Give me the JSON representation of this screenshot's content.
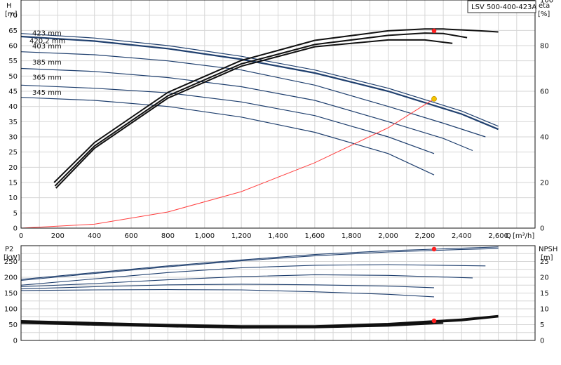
{
  "chart_data": {
    "type": "line",
    "title": "LSV 500-400-423A",
    "colors": {
      "curve": "#1f3f6e",
      "efficiency": "#111111",
      "system": "#ff4040",
      "dutyPoint": "#ff2020",
      "bep": "#f5c400",
      "grid": "#d6d6d6"
    },
    "head": {
      "ylabel": "H",
      "yunit": "[m]",
      "ylabel_right": "eta",
      "yunit_right": "[%]",
      "xlabel": "Q",
      "xunit": "[m³/h]",
      "xlim": [
        0,
        2800
      ],
      "ylim": [
        0,
        75
      ],
      "ylim_right": [
        0,
        100
      ],
      "xticks": [
        "0",
        "200",
        "400",
        "600",
        "800",
        "1,000",
        "1,200",
        "1,400",
        "1,600",
        "1,800",
        "2,000",
        "2,200",
        "2,400",
        "2,600"
      ],
      "xtick_values": [
        0,
        200,
        400,
        600,
        800,
        1000,
        1200,
        1400,
        1600,
        1800,
        2000,
        2200,
        2400,
        2600
      ],
      "yticks": [
        "0",
        "5",
        "10",
        "15",
        "20",
        "25",
        "30",
        "35",
        "40",
        "45",
        "50",
        "55",
        "60",
        "65",
        "70"
      ],
      "ytick_values": [
        0,
        5,
        10,
        15,
        20,
        25,
        30,
        35,
        40,
        45,
        50,
        55,
        60,
        65,
        70
      ],
      "yticks_right": [
        "0",
        "20",
        "40",
        "60",
        "80",
        "100"
      ],
      "ytick_values_right": [
        0,
        20,
        40,
        60,
        80,
        100
      ],
      "series": [
        {
          "name": "423 mm",
          "x": [
            0,
            400,
            800,
            1200,
            1600,
            2000,
            2400,
            2600
          ],
          "y": [
            64,
            62.5,
            60,
            56.5,
            52,
            46,
            38.5,
            33.5
          ]
        },
        {
          "name": "420,2 mm",
          "x": [
            0,
            400,
            800,
            1200,
            1600,
            2000,
            2400,
            2600
          ],
          "y": [
            63,
            61.5,
            59,
            55.5,
            51,
            45,
            37.5,
            32.5
          ]
        },
        {
          "name": "403 mm",
          "x": [
            0,
            400,
            800,
            1200,
            1600,
            2000,
            2300,
            2530
          ],
          "y": [
            58,
            57,
            55,
            52,
            47,
            40,
            34.5,
            30
          ]
        },
        {
          "name": "385 mm",
          "x": [
            0,
            400,
            800,
            1200,
            1600,
            2000,
            2300,
            2460
          ],
          "y": [
            52.5,
            51.5,
            49.5,
            46.5,
            42,
            35,
            29.5,
            25.5
          ]
        },
        {
          "name": "365 mm",
          "x": [
            0,
            400,
            800,
            1200,
            1600,
            2000,
            2250
          ],
          "y": [
            47,
            46,
            44.5,
            41.5,
            37,
            30,
            24.5
          ]
        },
        {
          "name": "345 mm",
          "x": [
            0,
            400,
            800,
            1200,
            1600,
            2000,
            2250
          ],
          "y": [
            43,
            42,
            40,
            36.5,
            31.5,
            24.5,
            17.5
          ]
        }
      ],
      "efficiency": [
        {
          "x": [
            180,
            400,
            800,
            1200,
            1600,
            2000,
            2200,
            2300,
            2500,
            2600
          ],
          "y": [
            20,
            37.5,
            59.5,
            73.5,
            82.3,
            86.5,
            87.3,
            87.3,
            86.5,
            86
          ]
        },
        {
          "x": [
            185,
            400,
            800,
            1200,
            1600,
            2000,
            2200,
            2300,
            2430
          ],
          "y": [
            18.5,
            36,
            58,
            72,
            80.5,
            84.5,
            85.5,
            85.3,
            83.5
          ]
        },
        {
          "x": [
            190,
            400,
            800,
            1200,
            1600,
            2000,
            2200,
            2350
          ],
          "y": [
            17.5,
            35,
            57,
            71,
            79.5,
            82.5,
            82.5,
            81
          ]
        }
      ],
      "system_curve": {
        "x": [
          0,
          400,
          800,
          1200,
          1600,
          2000,
          2250
        ],
        "y": [
          0,
          1.3,
          5.3,
          12,
          21.5,
          33,
          42.5
        ]
      },
      "duty_point": {
        "x": 2250,
        "y": 42.5
      },
      "eta_point": {
        "x": 2250,
        "y_pct": 86.5
      }
    },
    "power": {
      "ylabel": "P2",
      "yunit": "[kW]",
      "ylabel_right": "NPSH",
      "yunit_right": "[m]",
      "xlim": [
        0,
        2800
      ],
      "ylim": [
        0,
        300
      ],
      "ylim_right": [
        0,
        30
      ],
      "yticks": [
        "0",
        "50",
        "100",
        "150",
        "200",
        "250"
      ],
      "ytick_values": [
        0,
        50,
        100,
        150,
        200,
        250
      ],
      "yticks_right": [
        "0",
        "5",
        "10",
        "15",
        "20",
        "25"
      ],
      "ytick_values_right": [
        0,
        5,
        10,
        15,
        20,
        25
      ],
      "series": [
        {
          "x": [
            0,
            400,
            800,
            1200,
            1600,
            2000,
            2400,
            2600
          ],
          "y": [
            193,
            215,
            236,
            255,
            272,
            284,
            292,
            296
          ]
        },
        {
          "x": [
            0,
            400,
            800,
            1200,
            1600,
            2000,
            2400,
            2600
          ],
          "y": [
            190,
            212,
            233,
            252,
            268,
            280,
            288,
            291
          ]
        },
        {
          "x": [
            0,
            400,
            800,
            1200,
            1600,
            2000,
            2530
          ],
          "y": [
            175,
            195,
            215,
            230,
            238,
            240,
            236
          ]
        },
        {
          "x": [
            0,
            400,
            800,
            1200,
            1600,
            2000,
            2460
          ],
          "y": [
            170,
            180,
            192,
            202,
            208,
            206,
            198
          ]
        },
        {
          "x": [
            0,
            400,
            800,
            1200,
            1600,
            2000,
            2250
          ],
          "y": [
            163,
            170,
            176,
            178,
            176,
            172,
            167
          ]
        },
        {
          "x": [
            0,
            400,
            800,
            1200,
            1600,
            2000,
            2250
          ],
          "y": [
            158,
            160,
            161,
            160,
            154,
            146,
            138
          ]
        }
      ],
      "npsh": [
        {
          "x": [
            0,
            400,
            800,
            1200,
            1600,
            2000,
            2400,
            2600
          ],
          "y": [
            6.2,
            5.6,
            5.0,
            4.6,
            4.6,
            5.3,
            6.7,
            7.8
          ]
        },
        {
          "x": [
            0,
            400,
            800,
            1200,
            1600,
            2000,
            2400,
            2600
          ],
          "y": [
            5.8,
            5.2,
            4.6,
            4.3,
            4.3,
            4.9,
            6.3,
            7.5
          ]
        },
        {
          "x": [
            0,
            400,
            800,
            1200,
            1600,
            2000,
            2300
          ],
          "y": [
            5.5,
            4.9,
            4.4,
            4.0,
            4.1,
            4.6,
            5.5
          ]
        }
      ],
      "power_point": {
        "x": 2250,
        "y": 289
      },
      "npsh_point": {
        "x": 2250,
        "y": 6.2
      }
    }
  }
}
